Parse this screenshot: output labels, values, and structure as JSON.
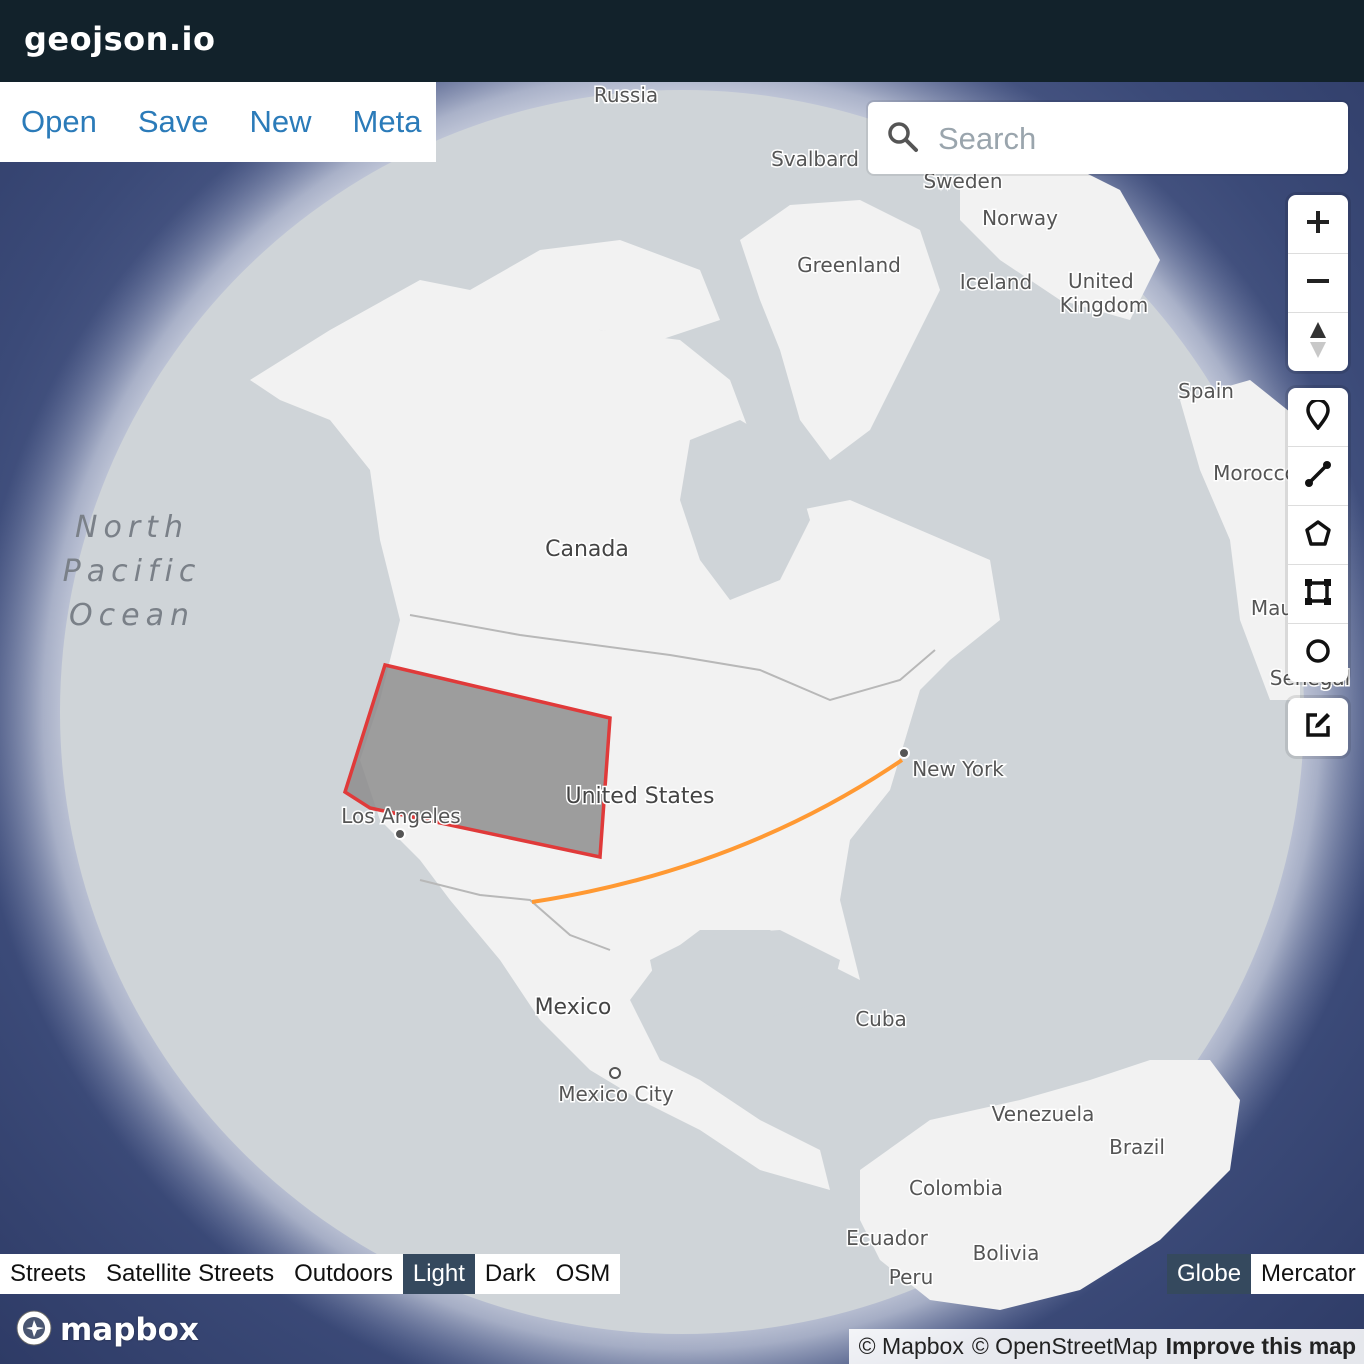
{
  "app": {
    "brand": "geojson.io"
  },
  "menu": {
    "items": [
      "Open",
      "Save",
      "New",
      "Meta"
    ]
  },
  "search": {
    "placeholder": "Search",
    "icon": "search-icon"
  },
  "controls": {
    "navigation": [
      "zoom-in-icon",
      "zoom-out-icon",
      "compass-icon"
    ],
    "draw": [
      "marker-icon",
      "line-icon",
      "polygon-icon",
      "rectangle-icon",
      "circle-icon"
    ],
    "edit": [
      "edit-icon"
    ]
  },
  "map": {
    "labels": {
      "russia": "Russia",
      "svalbard": "Svalbard",
      "sweden": "Sweden",
      "norway": "Norway",
      "greenland": "Greenland",
      "iceland": "Iceland",
      "uk": "United\nKingdom",
      "spain": "Spain",
      "morocco": "Morocco",
      "mauritania": "Mau",
      "senegal": "Senegal",
      "ocean_line1": "North",
      "ocean_line2": "Pacific",
      "ocean_line3": "Ocean",
      "canada": "Canada",
      "usa": "United States",
      "los_angeles": "Los Angeles",
      "new_york": "New York",
      "mexico": "Mexico",
      "mexico_city": "Mexico City",
      "cuba": "Cuba",
      "venezuela": "Venezuela",
      "brazil": "Brazil",
      "colombia": "Colombia",
      "ecuador": "Ecuador",
      "bolivia": "Bolivia",
      "peru": "Peru"
    },
    "features": {
      "polygon": {
        "fill": "#8a8a8a",
        "stroke": "#e03a3a"
      },
      "line": {
        "stroke": "#ff9933"
      }
    },
    "colors": {
      "land": "#f2f2f2",
      "water": "#cfd4d8",
      "space": "#3b4a78",
      "header": "#12222b",
      "link": "#2b7bb9"
    }
  },
  "styles": {
    "items": [
      "Streets",
      "Satellite Streets",
      "Outdoors",
      "Light",
      "Dark",
      "OSM"
    ],
    "active": "Light"
  },
  "projection": {
    "items": [
      "Globe",
      "Mercator"
    ],
    "active": "Globe"
  },
  "logo": {
    "text": "mapbox"
  },
  "attribution": {
    "mapbox": "© Mapbox",
    "osm": "© OpenStreetMap",
    "improve": "Improve this map"
  }
}
